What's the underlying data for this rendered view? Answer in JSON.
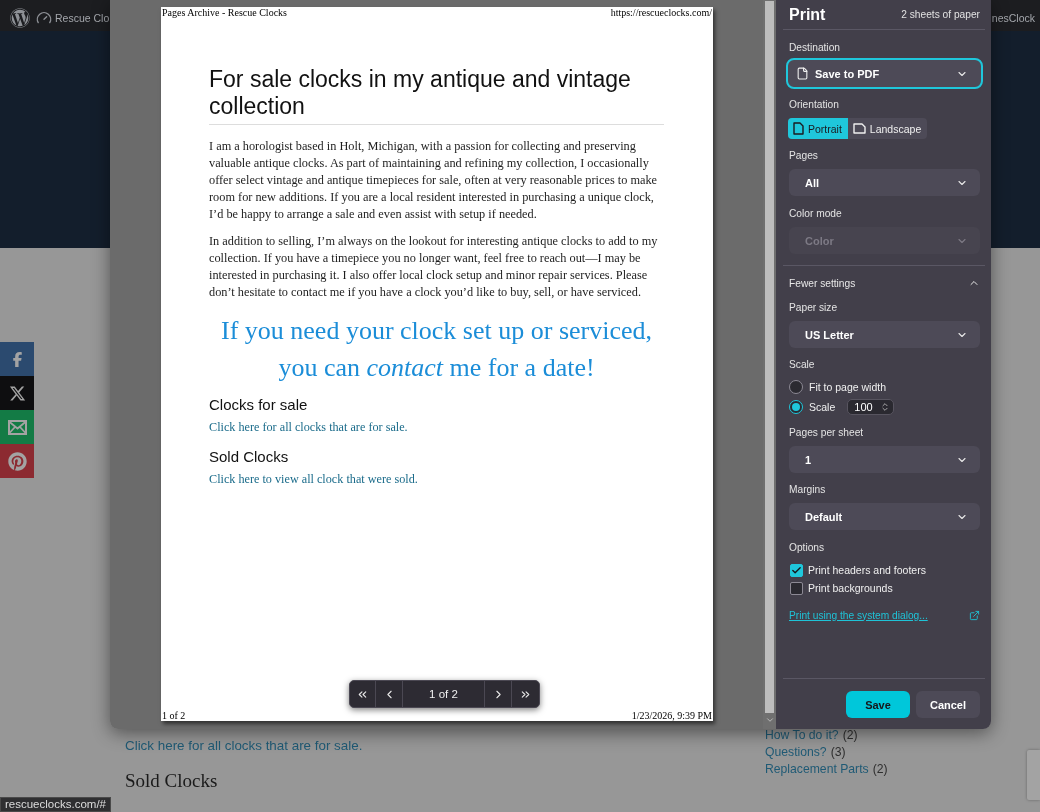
{
  "background_page": {
    "admin_bar": {
      "site_name": "Rescue Clo",
      "account": "nesClock"
    },
    "share_buttons": [
      {
        "kind": "facebook"
      },
      {
        "kind": "x"
      },
      {
        "kind": "email"
      },
      {
        "kind": "pinterest"
      }
    ],
    "content": {
      "link": "Click here for all clocks that are for sale.",
      "heading": "Sold Clocks"
    },
    "sidebar": {
      "categories": [
        {
          "label": "How To do it?",
          "count": "(2)"
        },
        {
          "label": "Questions?",
          "count": "(3)"
        },
        {
          "label": "Replacement Parts",
          "count": "(2)"
        }
      ]
    },
    "status_bar": {
      "url": "rescueclocks.com/#"
    }
  },
  "print_preview": {
    "page": {
      "header_left": "Pages Archive - Rescue Clocks",
      "header_right": "https://rescueclocks.com/",
      "title": "For sale clocks in my antique and vintage collection",
      "paragraphs": [
        "I am a horologist based in Holt, Michigan, with a passion for collecting and preserving valuable antique clocks. As part of maintaining and refining my collection, I occasionally offer select vintage and antique timepieces for sale, often at very reasonable prices to make room for new additions. If you are a local resident interested in purchasing a unique clock, I’d be happy to arrange a sale and even assist with setup if needed.",
        "In addition to selling, I’m always on the lookout for interesting antique clocks to add to my collection. If you have a timepiece you no longer want, feel free to reach out—I may be interested in purchasing it. I also offer local clock setup and minor repair services. Please don’t hesitate to contact me if you have a clock you’d like to buy, sell, or have serviced."
      ],
      "callout_lines": [
        "If you need your clock set up or serviced,",
        "you can *contact* me for a date!"
      ],
      "sections": [
        {
          "heading": "Clocks for sale",
          "link": "Click here for all clocks that are for sale."
        },
        {
          "heading": "Sold Clocks",
          "link": "Click here to view all clock that were sold."
        }
      ],
      "footer_left": "1 of 2",
      "footer_right": "1/23/2026, 9:39 PM"
    },
    "pager": {
      "label": "1 of 2"
    }
  },
  "print_settings": {
    "title": "Print",
    "summary": "2 sheets of paper",
    "destination": {
      "label": "Destination",
      "value": "Save to PDF",
      "focused": true
    },
    "orientation": {
      "label": "Orientation",
      "options": [
        {
          "label": "Portrait",
          "kind": "portrait",
          "selected": true
        },
        {
          "label": "Landscape",
          "kind": "landscape",
          "selected": false
        }
      ]
    },
    "pages": {
      "label": "Pages",
      "value": "All"
    },
    "color_mode": {
      "label": "Color mode",
      "value": "Color",
      "disabled": true
    },
    "more_settings": {
      "label": "Fewer settings",
      "expanded": true
    },
    "paper_size": {
      "label": "Paper size",
      "value": "US Letter"
    },
    "scale": {
      "label": "Scale",
      "options": [
        {
          "label": "Fit to page width",
          "selected": false
        },
        {
          "label": "Scale",
          "selected": true
        }
      ],
      "value": "100"
    },
    "pages_per_sheet": {
      "label": "Pages per sheet",
      "value": "1"
    },
    "margins": {
      "label": "Margins",
      "value": "Default"
    },
    "options": {
      "label": "Options",
      "checkboxes": [
        {
          "label": "Print headers and footers",
          "checked": true
        },
        {
          "label": "Print backgrounds",
          "checked": false
        }
      ]
    },
    "system_dialog_link": "Print using the system dialog...",
    "buttons": [
      {
        "label": "Save",
        "kind": "primary"
      },
      {
        "label": "Cancel",
        "kind": "secondary"
      }
    ]
  }
}
